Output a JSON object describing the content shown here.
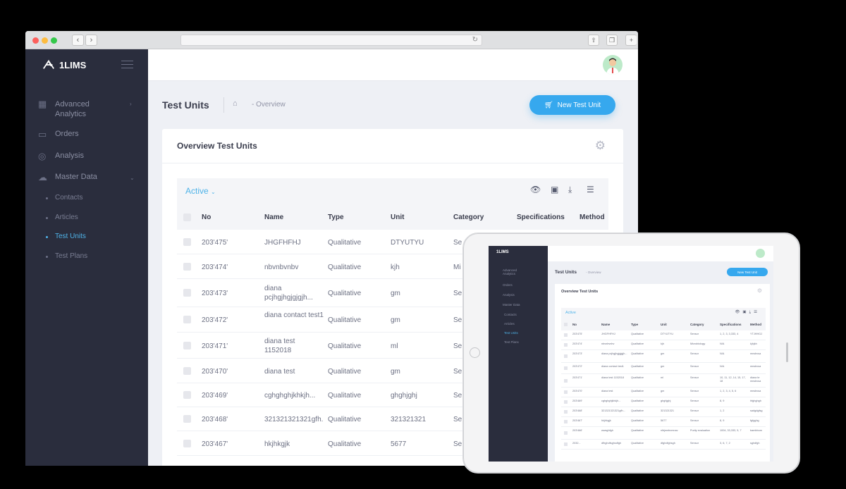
{
  "app": {
    "name": "1LIMS"
  },
  "sidebar": {
    "items": [
      {
        "label": "Advanced Analytics",
        "icon": "chart-icon"
      },
      {
        "label": "Orders",
        "icon": "orders-icon"
      },
      {
        "label": "Analysis",
        "icon": "analysis-icon"
      },
      {
        "label": "Master Data",
        "icon": "cloud-icon"
      }
    ],
    "subitems": [
      {
        "label": "Contacts"
      },
      {
        "label": "Articles"
      },
      {
        "label": "Test Units",
        "active": true
      },
      {
        "label": "Test Plans"
      }
    ]
  },
  "header": {
    "title": "Test Units",
    "breadcrumb": "- Overview",
    "new_button": "New Test Unit"
  },
  "card": {
    "title": "Overview Test Units",
    "filter": "Active"
  },
  "table": {
    "columns": [
      "No",
      "Name",
      "Type",
      "Unit",
      "Category",
      "Specifications",
      "Method"
    ],
    "rows": [
      [
        "203'475'",
        "JHGFHFHJ",
        "Qualitative",
        "DTYUTYU",
        "Se"
      ],
      [
        "203'474'",
        "nbvnbvnbv",
        "Qualitative",
        "kjh",
        "Mi"
      ],
      [
        "203'473'",
        "diana pcjhgjhgjgjgjh...",
        "Qualitative",
        "gm",
        "Se"
      ],
      [
        "203'472'",
        "diana contact test1",
        "Qualitative",
        "gm",
        "Se"
      ],
      [
        "203'471'",
        "diana test 1152018",
        "Qualitative",
        "ml",
        "Se"
      ],
      [
        "203'470'",
        "diana test",
        "Qualitative",
        "gm",
        "Se"
      ],
      [
        "203'469'",
        "cghghghjkhkjh...",
        "Qualitative",
        "ghghjghj",
        "Se"
      ],
      [
        "203'468'",
        "321321321321gfh...",
        "Qualitative",
        "321321321",
        "Se"
      ],
      [
        "203'467'",
        "hkjhkgjk",
        "Qualitative",
        "5677",
        "Se"
      ]
    ]
  },
  "tablet": {
    "table_rows": [
      [
        "203'475'",
        "JHGFHFHJ",
        "Qualitative",
        "DTYUTYU",
        "Sensor",
        "1, 2, 3, 3,333, 4",
        "YTJHHGJ"
      ],
      [
        "203'474'",
        "nbvnbvnbv",
        "Qualitative",
        "kjh",
        "Microbiology",
        "N/A",
        "kjhjkh"
      ],
      [
        "203'473'",
        "diana pcjhgjhgjgjgjh...",
        "Qualitative",
        "gm",
        "Sensor",
        "N/A",
        "mnsbvsa"
      ],
      [
        "203'472'",
        "diana contact test1",
        "Qualitative",
        "gm",
        "Sensor",
        "N/A",
        "mnsbvsa"
      ],
      [
        "203'471'",
        "diana test 1152018",
        "Qualitative",
        "ml",
        "Sensor",
        "10, 11, 12, 14, 15, 17, 18",
        "diana te mnsbvsa"
      ],
      [
        "203'470'",
        "diana test",
        "Qualitative",
        "gm",
        "Sensor",
        "1, 2, 3, 4, 5, 6",
        "mnsbvsa"
      ],
      [
        "203'469'",
        "cghghghjkhkjh...",
        "Qualitative",
        "ghghjghj",
        "Sensor",
        "8, 9",
        "hfghghgh"
      ],
      [
        "203'468'",
        "321321321321gfh...",
        "Qualitative",
        "321321321",
        "Sensor",
        "1, 2",
        "sadgdgfsg"
      ],
      [
        "203'467'",
        "hkjhkgjk",
        "Qualitative",
        "5677",
        "Sensor",
        "8, 9",
        "fgfgghg"
      ],
      [
        "203'466'",
        "wwsghfgh",
        "Qualitative",
        "nlbjmnbvmnav",
        "Purity evaluation",
        "1004, 33,333, 5, 7",
        "bambbum"
      ],
      [
        "2032...",
        "dfhghdfsghsdfgh",
        "Qualitative",
        "dfghdfghsgh",
        "Sensor",
        "3, 6, 7, 2",
        "sghdfgh"
      ]
    ]
  }
}
